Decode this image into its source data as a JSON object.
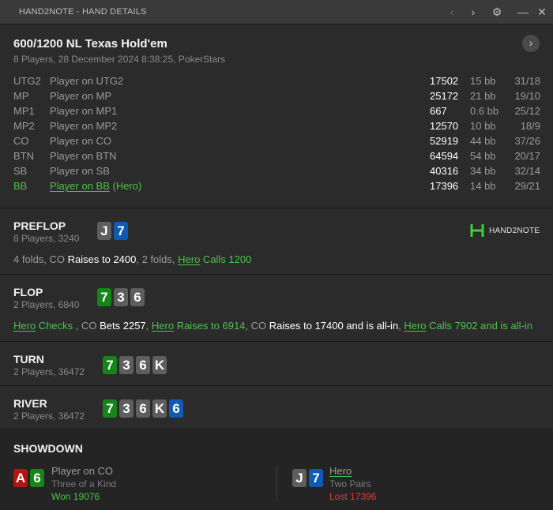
{
  "window": {
    "title": "HAND2NOTE - HAND DETAILS",
    "prev_icon": "chevron-left-icon",
    "next_icon": "chevron-right-icon",
    "settings_icon": "gear-icon",
    "minimize_icon": "minimize-icon",
    "close_icon": "close-icon"
  },
  "header": {
    "title": "600/1200 NL Texas Hold'em",
    "subtitle": "8 Players, 28 December 2024 8:38:25, PokerStars"
  },
  "players": [
    {
      "pos": "UTG2",
      "name": "Player on UTG2",
      "hero_suffix": "",
      "stack": "17502",
      "bb": "15 bb",
      "stats": "31/18"
    },
    {
      "pos": "MP",
      "name": "Player on MP",
      "hero_suffix": "",
      "stack": "25172",
      "bb": "21 bb",
      "stats": "19/10"
    },
    {
      "pos": "MP1",
      "name": "Player on MP1",
      "hero_suffix": "",
      "stack": "667",
      "bb": "0.6 bb",
      "stats": "25/12"
    },
    {
      "pos": "MP2",
      "name": "Player on MP2",
      "hero_suffix": "",
      "stack": "12570",
      "bb": "10 bb",
      "stats": "18/9"
    },
    {
      "pos": "CO",
      "name": "Player on CO",
      "hero_suffix": "",
      "stack": "52919",
      "bb": "44 bb",
      "stats": "37/26"
    },
    {
      "pos": "BTN",
      "name": "Player on BTN",
      "hero_suffix": "",
      "stack": "64594",
      "bb": "54 bb",
      "stats": "20/17"
    },
    {
      "pos": "SB",
      "name": "Player on SB",
      "hero_suffix": "",
      "stack": "40316",
      "bb": "34 bb",
      "stats": "32/14"
    },
    {
      "pos": "BB",
      "name": "Player on BB",
      "hero_suffix": " (Hero)",
      "stack": "17396",
      "bb": "14 bb",
      "stats": "29/21"
    }
  ],
  "logo": {
    "text": "HAND2NOTE"
  },
  "preflop": {
    "title": "PREFLOP",
    "sub": "8 Players, 3240",
    "cards": [
      {
        "rank": "J",
        "color": "gray"
      },
      {
        "rank": "7",
        "color": "blue"
      }
    ],
    "actions": [
      {
        "text": "4 folds, CO ",
        "style": "plain"
      },
      {
        "text": "Raises to 2400",
        "style": "white"
      },
      {
        "text": ", 2 folds, ",
        "style": "plain"
      },
      {
        "text": "Hero",
        "style": "hero-ul"
      },
      {
        "text": " Calls 1200",
        "style": "hero"
      }
    ]
  },
  "flop": {
    "title": "FLOP",
    "sub": "2 Players, 6840",
    "cards": [
      {
        "rank": "7",
        "color": "green"
      },
      {
        "rank": "3",
        "color": "gray"
      },
      {
        "rank": "6",
        "color": "gray"
      }
    ],
    "actions": [
      {
        "text": "Hero",
        "style": "hero-ul"
      },
      {
        "text": " Checks ",
        "style": "hero"
      },
      {
        "text": ", CO ",
        "style": "plain"
      },
      {
        "text": "Bets 2257",
        "style": "white"
      },
      {
        "text": ", ",
        "style": "plain"
      },
      {
        "text": "Hero",
        "style": "hero-ul"
      },
      {
        "text": " Raises to 6914",
        "style": "hero"
      },
      {
        "text": ", CO ",
        "style": "plain"
      },
      {
        "text": "Raises to 17400 and is all-in",
        "style": "white"
      },
      {
        "text": ", ",
        "style": "plain"
      },
      {
        "text": "Hero",
        "style": "hero-ul"
      },
      {
        "text": " Calls 7902 and is all-in",
        "style": "hero"
      }
    ]
  },
  "turn": {
    "title": "TURN",
    "sub": "2 Players, 36472",
    "cards": [
      {
        "rank": "7",
        "color": "green"
      },
      {
        "rank": "3",
        "color": "gray"
      },
      {
        "rank": "6",
        "color": "gray"
      },
      {
        "rank": "K",
        "color": "gray"
      }
    ]
  },
  "river": {
    "title": "RIVER",
    "sub": "2 Players, 36472",
    "cards": [
      {
        "rank": "7",
        "color": "green"
      },
      {
        "rank": "3",
        "color": "gray"
      },
      {
        "rank": "6",
        "color": "gray"
      },
      {
        "rank": "K",
        "color": "gray"
      },
      {
        "rank": "6",
        "color": "blue"
      }
    ]
  },
  "showdown": {
    "title": "SHOWDOWN",
    "winner": {
      "name": "Player on CO",
      "desc": "Three of a Kind",
      "result": "Won 19076",
      "cards": [
        {
          "rank": "A",
          "color": "red"
        },
        {
          "rank": "6",
          "color": "green"
        }
      ]
    },
    "loser": {
      "name": "Hero",
      "desc": "Two Pairs",
      "result": "Lost 17396",
      "cards": [
        {
          "rank": "J",
          "color": "gray"
        },
        {
          "rank": "7",
          "color": "blue"
        }
      ]
    }
  }
}
